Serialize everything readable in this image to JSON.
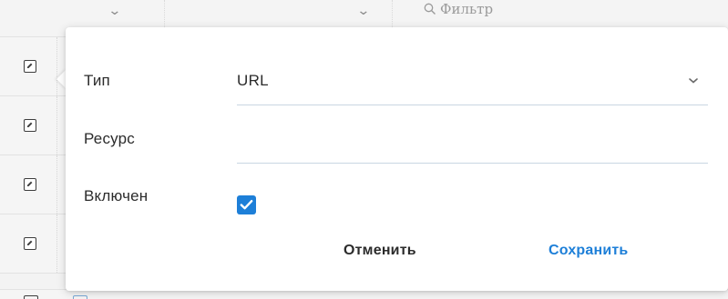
{
  "background_table": {
    "filter_placeholder": "Фильтр",
    "header_chevron_icon": "chevron-down-icon",
    "edit_icon": "edit-icon",
    "row_count_visible": 4
  },
  "popover": {
    "fields": {
      "type": {
        "label": "Тип",
        "value": "URL",
        "icon": "chevron-down-icon"
      },
      "resource": {
        "label": "Ресурс",
        "value": ""
      },
      "enabled": {
        "label": "Включен",
        "checked": true,
        "icon": "check-icon"
      }
    },
    "buttons": {
      "cancel": "Отменить",
      "save": "Сохранить"
    }
  },
  "colors": {
    "accent": "#1d7fd8",
    "text": "#2b2b2b",
    "underline": "#c9d6e2",
    "background": "#f3f3f3"
  }
}
